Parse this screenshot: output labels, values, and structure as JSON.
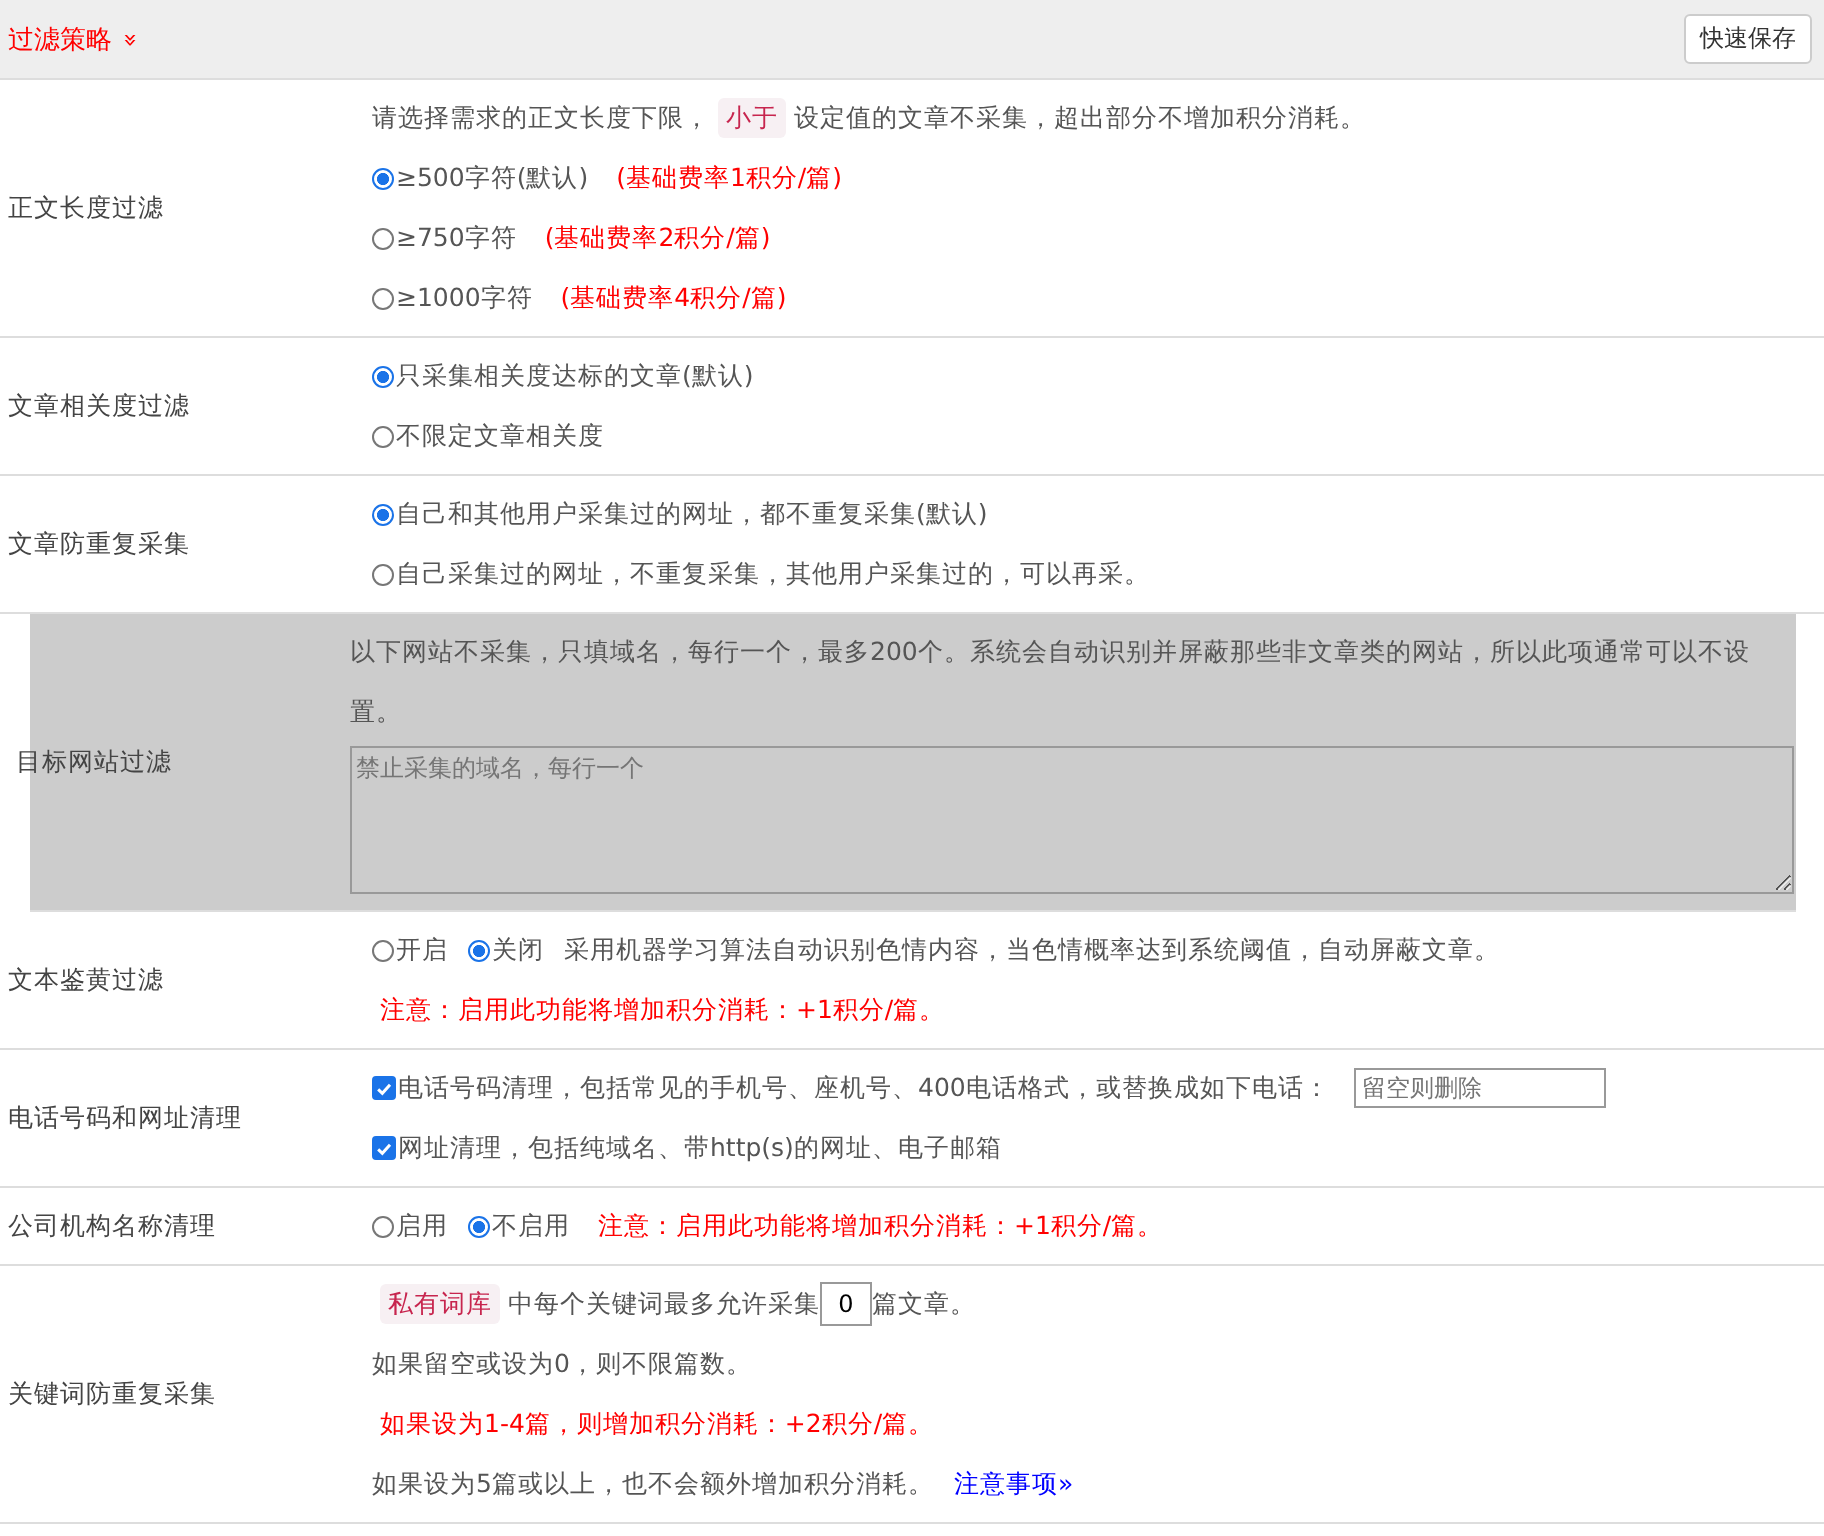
{
  "header": {
    "title": "过滤策略",
    "expand_icon": "»",
    "save_button": "快速保存"
  },
  "sections": [
    {
      "label": "正文长度过滤",
      "disabled": false,
      "lines": [
        [
          {
            "kind": "text",
            "text": "请选择需求的正文长度下限，"
          },
          {
            "kind": "tag",
            "text": "小于"
          },
          {
            "kind": "text",
            "text": "设定值的文章不采集，超出部分不增加积分消耗。"
          }
        ],
        [
          {
            "kind": "radio",
            "text": "≥500字符(默认)",
            "selected": true
          },
          {
            "kind": "note",
            "text": "(基础费率1积分/篇)"
          }
        ],
        [
          {
            "kind": "radio",
            "text": "≥750字符",
            "selected": false
          },
          {
            "kind": "note",
            "text": "(基础费率2积分/篇)"
          }
        ],
        [
          {
            "kind": "radio",
            "text": "≥1000字符",
            "selected": false
          },
          {
            "kind": "note",
            "text": "(基础费率4积分/篇)"
          }
        ]
      ]
    },
    {
      "label": "文章相关度过滤",
      "disabled": false,
      "lines": [
        [
          {
            "kind": "radio",
            "text": "只采集相关度达标的文章(默认)",
            "selected": true
          }
        ],
        [
          {
            "kind": "radio",
            "text": "不限定文章相关度",
            "selected": false
          }
        ]
      ]
    },
    {
      "label": "文章防重复采集",
      "disabled": false,
      "lines": [
        [
          {
            "kind": "radio",
            "text": "自己和其他用户采集过的网址，都不重复采集(默认)",
            "selected": true
          }
        ],
        [
          {
            "kind": "radio",
            "text": "自己采集过的网址，不重复采集，其他用户采集过的，可以再采。",
            "selected": false
          }
        ]
      ]
    },
    {
      "label": "目标网站过滤",
      "disabled": true,
      "lines": [
        [
          {
            "kind": "text",
            "text": "以下网站不采集，只填域名，每行一个，最多200个。系统会自动识别并屏蔽那些非文章类的网站，所以此项通常可以不设置。"
          }
        ],
        [
          {
            "kind": "textarea",
            "placeholder": "禁止采集的域名，每行一个"
          }
        ]
      ]
    },
    {
      "label": "文本鉴黄过滤",
      "disabled": false,
      "lines": [
        [
          {
            "kind": "radio",
            "text": "开启",
            "selected": false
          },
          {
            "kind": "radio",
            "text": "关闭",
            "selected": true
          },
          {
            "kind": "text",
            "text": "采用机器学习算法自动识别色情内容，当色情概率达到系统阈值，自动屏蔽文章。"
          }
        ],
        [
          {
            "kind": "note",
            "text": "注意：启用此功能将增加积分消耗：+1积分/篇。"
          }
        ]
      ]
    },
    {
      "label": "电话号码和网址清理",
      "disabled": false,
      "lines": [
        [
          {
            "kind": "checkbox",
            "text": "电话号码清理，包括常见的手机号、座机号、400电话格式，或替换成如下电话：",
            "checked": true
          },
          {
            "kind": "input",
            "placeholder": "留空则删除"
          }
        ],
        [
          {
            "kind": "checkbox",
            "text": "网址清理，包括纯域名、带http(s)的网址、电子邮箱",
            "checked": true
          }
        ]
      ]
    },
    {
      "label": "公司机构名称清理",
      "disabled": false,
      "lines": [
        [
          {
            "kind": "radio",
            "text": "启用",
            "selected": false
          },
          {
            "kind": "radio",
            "text": "不启用",
            "selected": true
          },
          {
            "kind": "note",
            "text": "注意：启用此功能将增加积分消耗：+1积分/篇。"
          }
        ]
      ]
    },
    {
      "label": "关键词防重复采集",
      "disabled": false,
      "lines": [
        [
          {
            "kind": "tag",
            "text": "私有词库"
          },
          {
            "kind": "text",
            "text": "中每个关键词最多允许采集"
          },
          {
            "kind": "number",
            "value": "0"
          },
          {
            "kind": "text",
            "text": "篇文章。"
          }
        ],
        [
          {
            "kind": "text",
            "text": "如果留空或设为0，则不限篇数。"
          }
        ],
        [
          {
            "kind": "note",
            "text": "如果设为1-4篇，则增加积分消耗：+2积分/篇。"
          }
        ],
        [
          {
            "kind": "text",
            "text": "如果设为5篇或以上，也不会额外增加积分消耗。"
          },
          {
            "kind": "link",
            "text": "注意事项",
            "icon": "»"
          }
        ]
      ]
    }
  ]
}
